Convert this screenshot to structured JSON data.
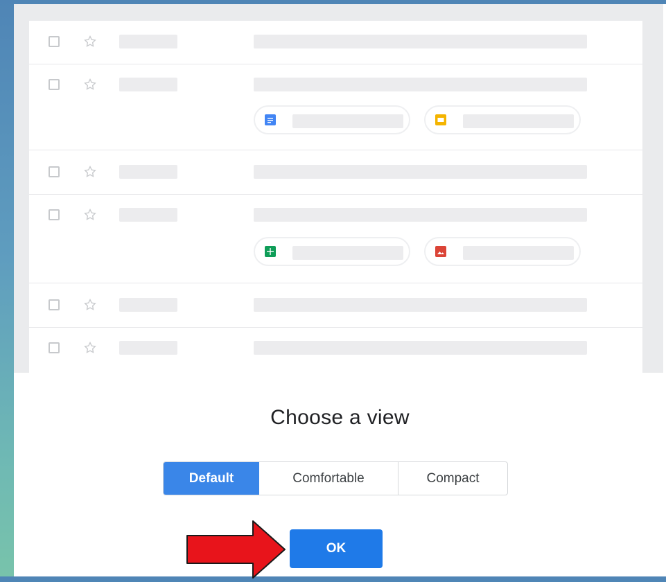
{
  "dialog": {
    "title": "Choose a view",
    "view_options": [
      "Default",
      "Comfortable",
      "Compact"
    ],
    "selected_view": "Default",
    "ok_label": "OK"
  },
  "colors": {
    "selected_option": "#3a86e8",
    "ok_button": "#1f7ae8",
    "arrow": "#e8141b",
    "docs_icon": "#4285f4",
    "slides_icon": "#f4b400",
    "sheets_icon": "#0f9d58",
    "image_icon": "#db4437"
  },
  "preview_rows": [
    {
      "attachments": []
    },
    {
      "attachments": [
        "docs-icon",
        "slides-icon"
      ]
    },
    {
      "attachments": []
    },
    {
      "attachments": [
        "sheets-icon",
        "image-icon"
      ]
    },
    {
      "attachments": []
    },
    {
      "attachments": []
    }
  ]
}
